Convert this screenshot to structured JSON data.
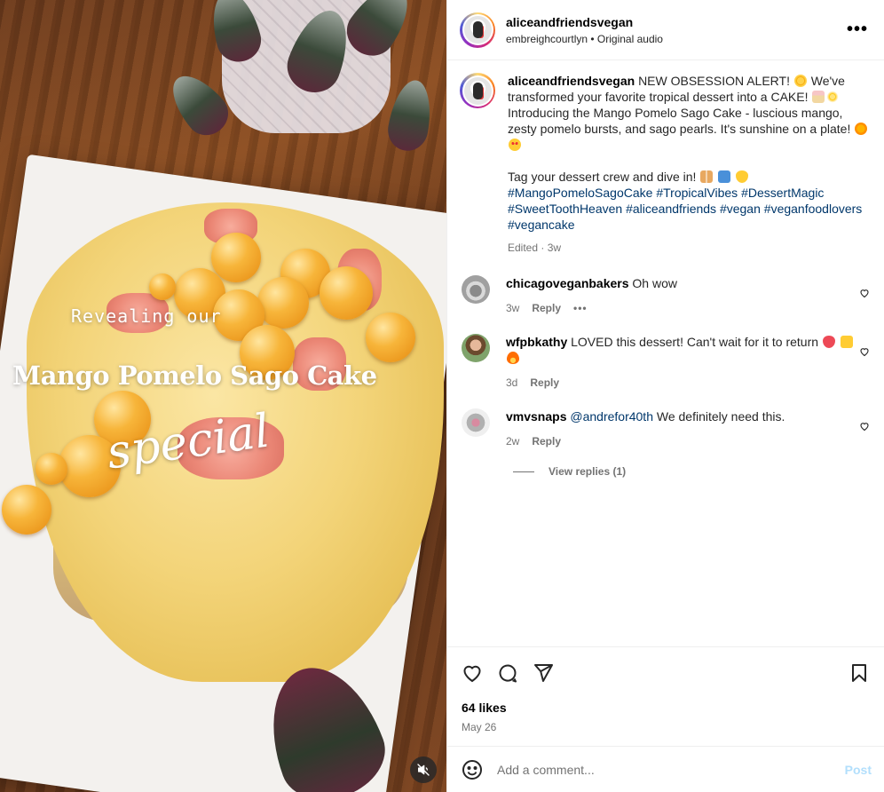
{
  "post": {
    "username": "aliceandfriendsvegan",
    "audio_user": "embreighcourtlyn",
    "audio_sep": " • ",
    "audio_label": "Original audio",
    "more": "•••"
  },
  "media": {
    "overlay_line1": "Revealing our",
    "overlay_title": "Mango Pomelo Sago Cake",
    "overlay_script": "special"
  },
  "caption": {
    "username": "aliceandfriendsvegan",
    "text1": "NEW OBSESSION ALERT! ",
    "text2": " We've transformed your favorite tropical dessert into a CAKE! ",
    "text3": " Introducing the Mango Pomelo Sago Cake - luscious mango, zesty pomelo bursts, and sago pearls. It's sunshine on a plate! ",
    "text4": "Tag your dessert crew and dive in! ",
    "hashtags": [
      "#MangoPomeloSagoCake",
      "#TropicalVibes",
      "#DessertMagic",
      "#SweetToothHeaven",
      "#aliceandfriends",
      "#vegan",
      "#veganfoodlovers",
      "#vegancake"
    ],
    "edited": "Edited",
    "time": "3w"
  },
  "comments": [
    {
      "username": "chicagoveganbakers",
      "text": "Oh wow",
      "time": "3w",
      "reply": "Reply",
      "more": "•••"
    },
    {
      "username": "wfpbkathy",
      "text": "LOVED this dessert! Can't wait for it to return ",
      "time": "3d",
      "reply": "Reply"
    },
    {
      "username": "vmvsnaps",
      "mention": "@andrefor40th",
      "text": " We definitely need this.",
      "time": "2w",
      "reply": "Reply"
    }
  ],
  "view_replies": "View replies (1)",
  "likes": "64 likes",
  "date": "May 26",
  "comment_box": {
    "placeholder": "Add a comment...",
    "post_label": "Post"
  },
  "icons": {
    "like": "heart-icon",
    "comment": "comment-bubble-icon",
    "share": "paper-plane-icon",
    "save": "bookmark-icon",
    "emoji": "smiley-icon",
    "mute": "speaker-muted-icon"
  },
  "colors": {
    "link": "#00376b",
    "muted": "#737373",
    "post_button": "#b2dffc",
    "heart_red": "#ed4956"
  }
}
